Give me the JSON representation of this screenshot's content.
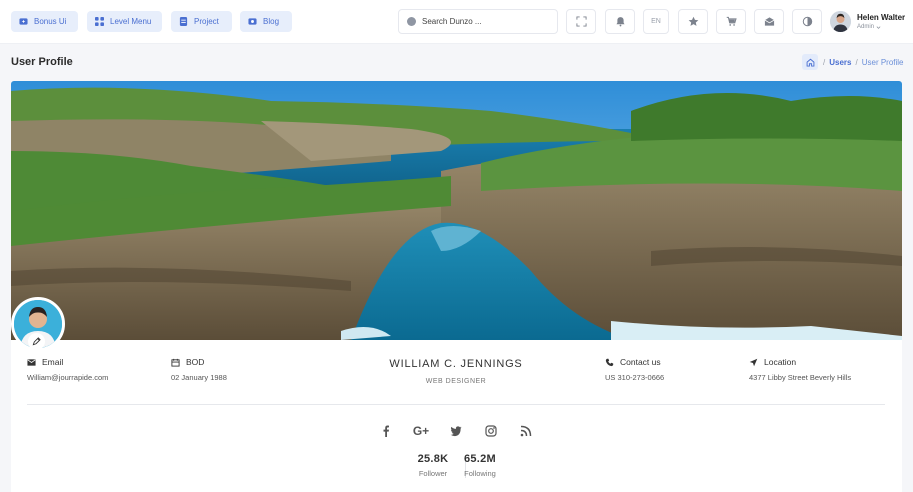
{
  "header": {
    "menu": [
      {
        "label": "Bonus Ui",
        "icon": "sparkle-icon"
      },
      {
        "label": "Level Menu",
        "icon": "grid-icon"
      },
      {
        "label": "Project",
        "icon": "document-icon"
      },
      {
        "label": "Blog",
        "icon": "image-icon"
      }
    ],
    "search_placeholder": "Search Dunzo ...",
    "language": "EN",
    "user": {
      "name": "Helen Walter",
      "role": "Admin"
    }
  },
  "page": {
    "title": "User Profile",
    "breadcrumb": [
      "Users",
      "User Profile"
    ],
    "breadcrumb_sep": "/"
  },
  "profile": {
    "email_label": "Email",
    "email": "William@jourrapide.com",
    "bod_label": "BOD",
    "bod": "02 January 1988",
    "name": "WILLIAM C. JENNINGS",
    "role": "WEB DESIGNER",
    "contact_label": "Contact us",
    "contact": "US 310-273-0666",
    "location_label": "Location",
    "location": "4377 Libby Street Beverly Hills",
    "socials": [
      "facebook",
      "google-plus",
      "twitter",
      "instagram",
      "rss"
    ],
    "gplus_text": "G+",
    "followers": "25.8K",
    "followers_label": "Follower",
    "following": "65.2M",
    "following_label": "Following"
  },
  "colors": {
    "accent": "#4a6fd1",
    "menu_bg": "#e7eefb"
  }
}
